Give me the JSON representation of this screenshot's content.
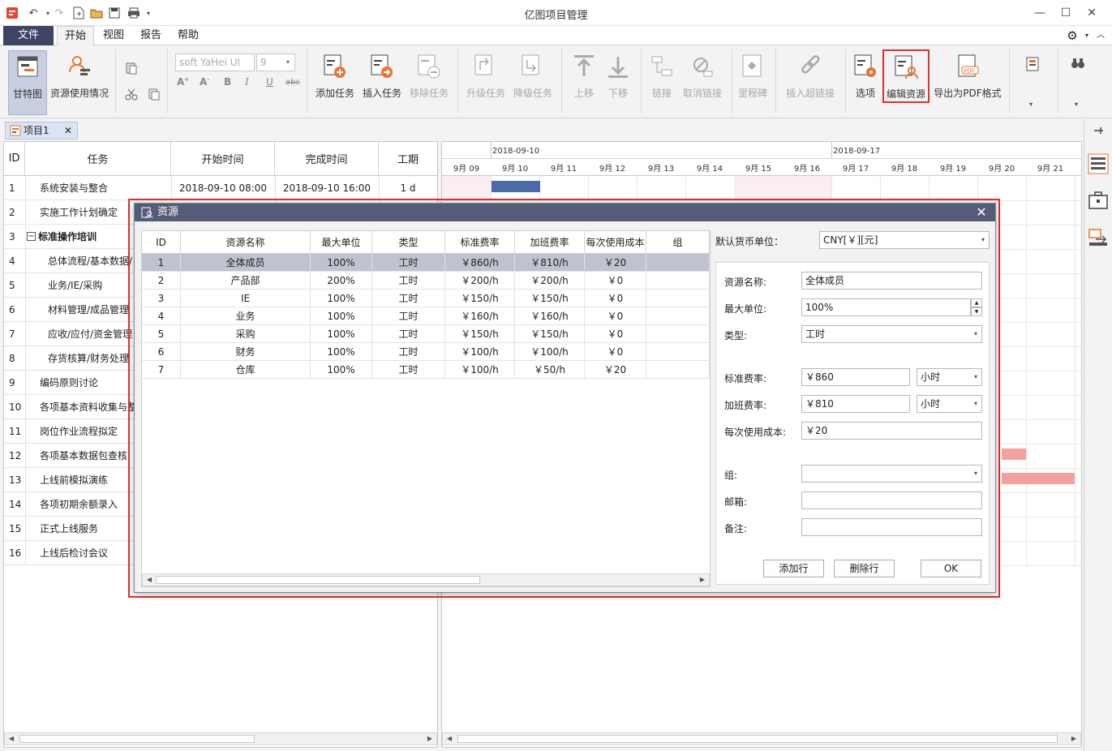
{
  "window": {
    "title": "亿图项目管理"
  },
  "menus": {
    "file": "文件",
    "home": "开始",
    "view": "视图",
    "report": "报告",
    "help": "帮助"
  },
  "ribbon": {
    "gantt": "甘特图",
    "resource_usage": "资源使用情况",
    "font_name": "soft YaHei UI",
    "font_size": "9",
    "add_task": "添加任务",
    "insert_task": "插入任务",
    "remove_task": "移除任务",
    "upgrade_task": "升级任务",
    "downgrade_task": "降级任务",
    "move_up": "上移",
    "move_down": "下移",
    "link": "链接",
    "unlink": "取消链接",
    "milestone": "里程碑",
    "insert_hyperlink": "插入超链接",
    "options": "选项",
    "edit_resource": "编辑资源",
    "export_pdf": "导出为PDF格式"
  },
  "doc_tab": {
    "label": "项目1"
  },
  "grid": {
    "headers": [
      "ID",
      "任务",
      "开始时间",
      "完成时间",
      "工期"
    ],
    "rows": [
      {
        "id": "1",
        "task": "系统安装与整合",
        "start": "2018-09-10 08:00",
        "end": "2018-09-10 16:00",
        "duration": "1 d",
        "level": 1
      },
      {
        "id": "2",
        "task": "实施工作计划确定",
        "start": "",
        "end": "",
        "duration": "",
        "level": 1
      },
      {
        "id": "3",
        "task": "标准操作培训",
        "start": "",
        "end": "",
        "duration": "",
        "level": 0
      },
      {
        "id": "4",
        "task": "总体流程/基本数据/",
        "start": "",
        "end": "",
        "duration": "",
        "level": 2
      },
      {
        "id": "5",
        "task": "业务/IE/采购",
        "start": "",
        "end": "",
        "duration": "",
        "level": 2
      },
      {
        "id": "6",
        "task": "材料管理/成品管理",
        "start": "",
        "end": "",
        "duration": "",
        "level": 2
      },
      {
        "id": "7",
        "task": "应收/应付/资金管理",
        "start": "",
        "end": "",
        "duration": "",
        "level": 2
      },
      {
        "id": "8",
        "task": "存货核算/财务处理",
        "start": "",
        "end": "",
        "duration": "",
        "level": 2
      },
      {
        "id": "9",
        "task": "编码原则讨论",
        "start": "",
        "end": "",
        "duration": "",
        "level": 1
      },
      {
        "id": "10",
        "task": "各项基本资料收集与整",
        "start": "",
        "end": "",
        "duration": "",
        "level": 1
      },
      {
        "id": "11",
        "task": "岗位作业流程拟定",
        "start": "",
        "end": "",
        "duration": "",
        "level": 1
      },
      {
        "id": "12",
        "task": "各项基本数据包查核",
        "start": "",
        "end": "",
        "duration": "",
        "level": 1
      },
      {
        "id": "13",
        "task": "上线前模拟演练",
        "start": "",
        "end": "",
        "duration": "",
        "level": 1
      },
      {
        "id": "14",
        "task": "各项初期余额录入",
        "start": "",
        "end": "",
        "duration": "",
        "level": 1
      },
      {
        "id": "15",
        "task": "正式上线服务",
        "start": "",
        "end": "",
        "duration": "",
        "level": 1
      },
      {
        "id": "16",
        "task": "上线后检讨会议",
        "start": "",
        "end": "",
        "duration": "",
        "level": 1
      }
    ]
  },
  "gantt": {
    "weeks": [
      "2018-09-10",
      "2018-09-17"
    ],
    "days": [
      "9月 09",
      "9月 10",
      "9月 11",
      "9月 12",
      "9月 13",
      "9月 14",
      "9月 15",
      "9月 16",
      "9月 17",
      "9月 18",
      "9月 19",
      "9月 20",
      "9月 21"
    ]
  },
  "dialog": {
    "title": "资源",
    "table_headers": [
      "ID",
      "资源名称",
      "最大单位",
      "类型",
      "标准费率",
      "加班费率",
      "每次使用成本",
      "组"
    ],
    "resources": [
      {
        "id": "1",
        "name": "全体成员",
        "max": "100%",
        "type": "工时",
        "std": "￥860/h",
        "ot": "￥810/h",
        "cost": "￥20",
        "group": ""
      },
      {
        "id": "2",
        "name": "产品部",
        "max": "200%",
        "type": "工时",
        "std": "￥200/h",
        "ot": "￥200/h",
        "cost": "￥0",
        "group": ""
      },
      {
        "id": "3",
        "name": "IE",
        "max": "100%",
        "type": "工时",
        "std": "￥150/h",
        "ot": "￥150/h",
        "cost": "￥0",
        "group": ""
      },
      {
        "id": "4",
        "name": "业务",
        "max": "100%",
        "type": "工时",
        "std": "￥160/h",
        "ot": "￥160/h",
        "cost": "￥0",
        "group": ""
      },
      {
        "id": "5",
        "name": "采购",
        "max": "100%",
        "type": "工时",
        "std": "￥150/h",
        "ot": "￥150/h",
        "cost": "￥0",
        "group": ""
      },
      {
        "id": "6",
        "name": "财务",
        "max": "100%",
        "type": "工时",
        "std": "￥100/h",
        "ot": "￥100/h",
        "cost": "￥0",
        "group": ""
      },
      {
        "id": "7",
        "name": "仓库",
        "max": "100%",
        "type": "工时",
        "std": "￥100/h",
        "ot": "￥50/h",
        "cost": "￥20",
        "group": ""
      }
    ],
    "currency_label": "默认货币单位：",
    "currency_value": "CNY[￥][元]",
    "form": {
      "name_label": "资源名称:",
      "name_value": "全体成员",
      "max_label": "最大单位:",
      "max_value": "100%",
      "type_label": "类型:",
      "type_value": "工时",
      "std_label": "标准费率:",
      "std_value": "￥860",
      "std_unit": "小时",
      "ot_label": "加班费率:",
      "ot_value": "￥810",
      "ot_unit": "小时",
      "cost_label": "每次使用成本:",
      "cost_value": "￥20",
      "group_label": "组:",
      "group_value": "",
      "email_label": "邮箱:",
      "email_value": "",
      "note_label": "备注:",
      "note_value": ""
    },
    "buttons": {
      "add_row": "添加行",
      "delete_row": "删除行",
      "ok": "OK"
    }
  },
  "colors": {
    "accent": "#3c4566",
    "dialog_title": "#555c78",
    "highlight": "#e0302f",
    "task_bar": "#4a6aa8",
    "resource_bar": "#f2a29e"
  }
}
